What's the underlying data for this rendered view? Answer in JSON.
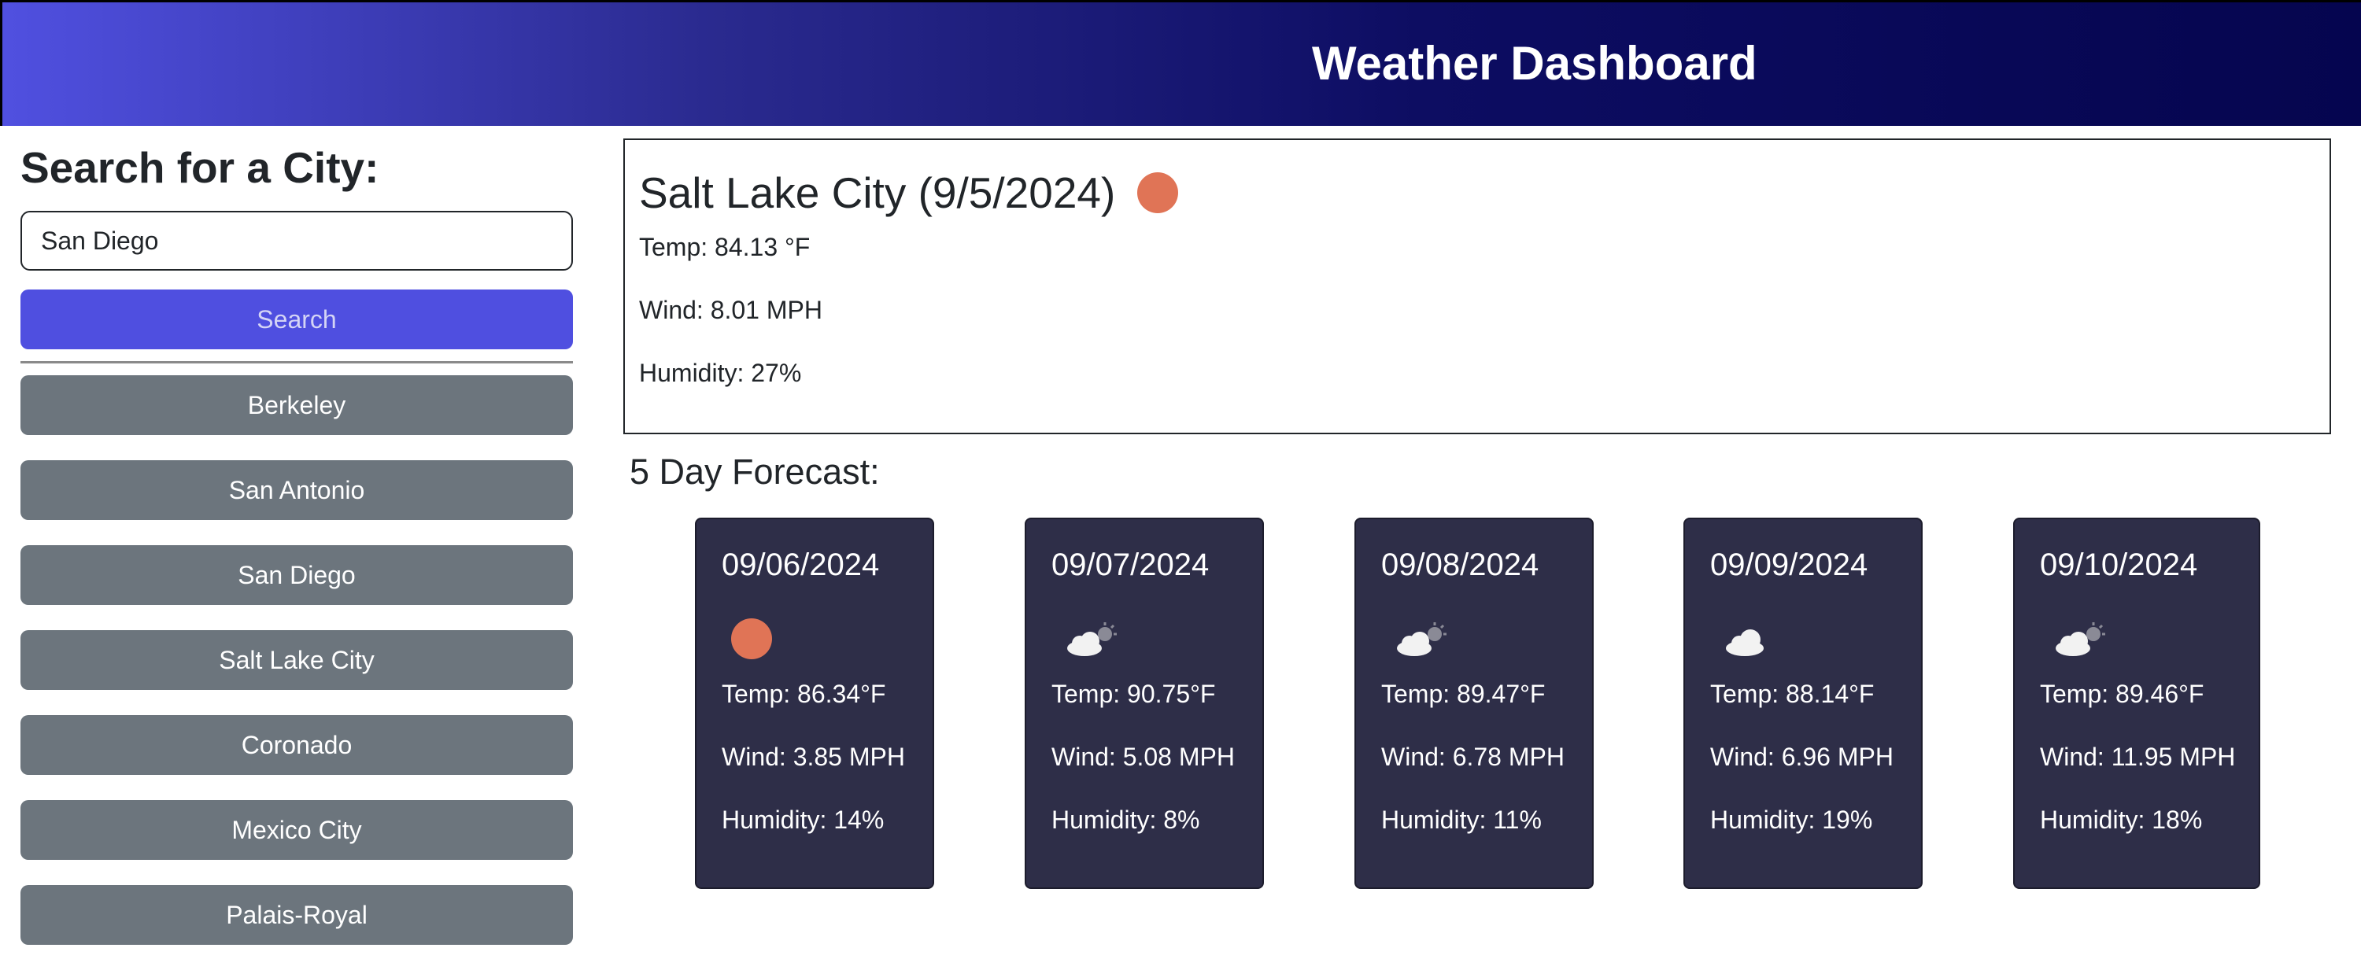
{
  "header": {
    "title": "Weather Dashboard"
  },
  "sidebar": {
    "heading": "Search for a City:",
    "search_value": "San Diego",
    "search_button_label": "Search",
    "history": [
      "Berkeley",
      "San Antonio",
      "San Diego",
      "Salt Lake City",
      "Coronado",
      "Mexico City",
      "Palais-Royal"
    ]
  },
  "current": {
    "title": "Salt Lake City (9/5/2024)",
    "icon": "sun-icon",
    "temp": "Temp: 84.13 °F",
    "wind": "Wind: 8.01 MPH",
    "humidity": "Humidity: 27%"
  },
  "forecast": {
    "heading": "5 Day Forecast:",
    "days": [
      {
        "date": "09/06/2024",
        "icon": "sun-icon",
        "temp": "Temp: 86.34°F",
        "wind": "Wind: 3.85 MPH",
        "humidity": "Humidity: 14%"
      },
      {
        "date": "09/07/2024",
        "icon": "partly-cloudy-icon",
        "temp": "Temp: 90.75°F",
        "wind": "Wind: 5.08 MPH",
        "humidity": "Humidity: 8%"
      },
      {
        "date": "09/08/2024",
        "icon": "partly-cloudy-icon",
        "temp": "Temp: 89.47°F",
        "wind": "Wind: 6.78 MPH",
        "humidity": "Humidity: 11%"
      },
      {
        "date": "09/09/2024",
        "icon": "cloud-icon",
        "temp": "Temp: 88.14°F",
        "wind": "Wind: 6.96 MPH",
        "humidity": "Humidity: 19%"
      },
      {
        "date": "09/10/2024",
        "icon": "partly-cloudy-icon",
        "temp": "Temp: 89.46°F",
        "wind": "Wind: 11.95 MPH",
        "humidity": "Humidity: 18%"
      }
    ]
  },
  "colors": {
    "header_gradient_start": "#5050e0",
    "header_gradient_end": "#05054f",
    "search_button": "#4f4fe0",
    "history_button": "#6c757d",
    "forecast_card": "#2e2e48",
    "sun": "#e07456"
  }
}
